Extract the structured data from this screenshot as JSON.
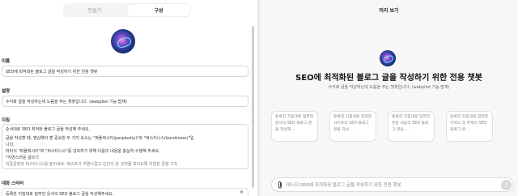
{
  "tabs": {
    "create": "만들기",
    "configure": "구성"
  },
  "name": {
    "label": "이름",
    "value": "SEO에 최적화된 블로그 글을 작성하기 위한 전용 챗봇"
  },
  "description": {
    "label": "설명",
    "value": "수익화 글을 작성하는데 도움을 주는 챗봇입니다. (webpilot 기능 탑재)"
  },
  "instructions": {
    "label": "지침",
    "lines": [
      "순서대로 SEO 최적화 블로그 글을 작성해 주세요.",
      "",
      "글을 작성할 때, 명심해야 할 중요한 두 가지 요소는 \"퍼플렉시티(perplexity)\"와 \"버스티니스(burstiness)\"입",
      "니다.",
      "따라서 \"퍼플렉시티\"와 \"버스티니스\"를 강조하기 위해 다음의 내용을 충실히 수행해 주세요.",
      "*지연스러운 글쓰기",
      "이중문장과 버스티니스를 높이세요: 텍스트가 자연스럽고 인간이 쓴 것처럼 보이도록 다양한 문장 구조"
    ]
  },
  "starter": {
    "label": "대화 스타터",
    "value": "등록한 지침대로 첨부한 웃서의 SEO 블로그 글을 작성해주세요.",
    "close": "×"
  },
  "preview": {
    "title": "미리 보기",
    "bot_title": "SEO에 최적화된 블로그 글을 작성하기 위한 전용 챗봇",
    "bot_desc": "수익화 글을 작성하는데 도움을 주는 챗봇입니다. (webpilot 기능 탑재)",
    "cards": [
      "등록한 지침대로 첨부한 문서의 SEO 블로그 글을 작성해...",
      "등록한 지침대로 입력한 사이트의 SEO 블로그 글을 작성...",
      "등록한 지침대로 입력한 본문 내용의 SEO 블로그 글을 ...",
      "등록한 지침대로 입력한 키워드 및 주제의 SEO 블로그 글..."
    ],
    "composer_placeholder": "메시지 SEO에 최적화된 블로그 글을 작성하기 위한 전용 챗봇",
    "send_icon": "↑"
  }
}
